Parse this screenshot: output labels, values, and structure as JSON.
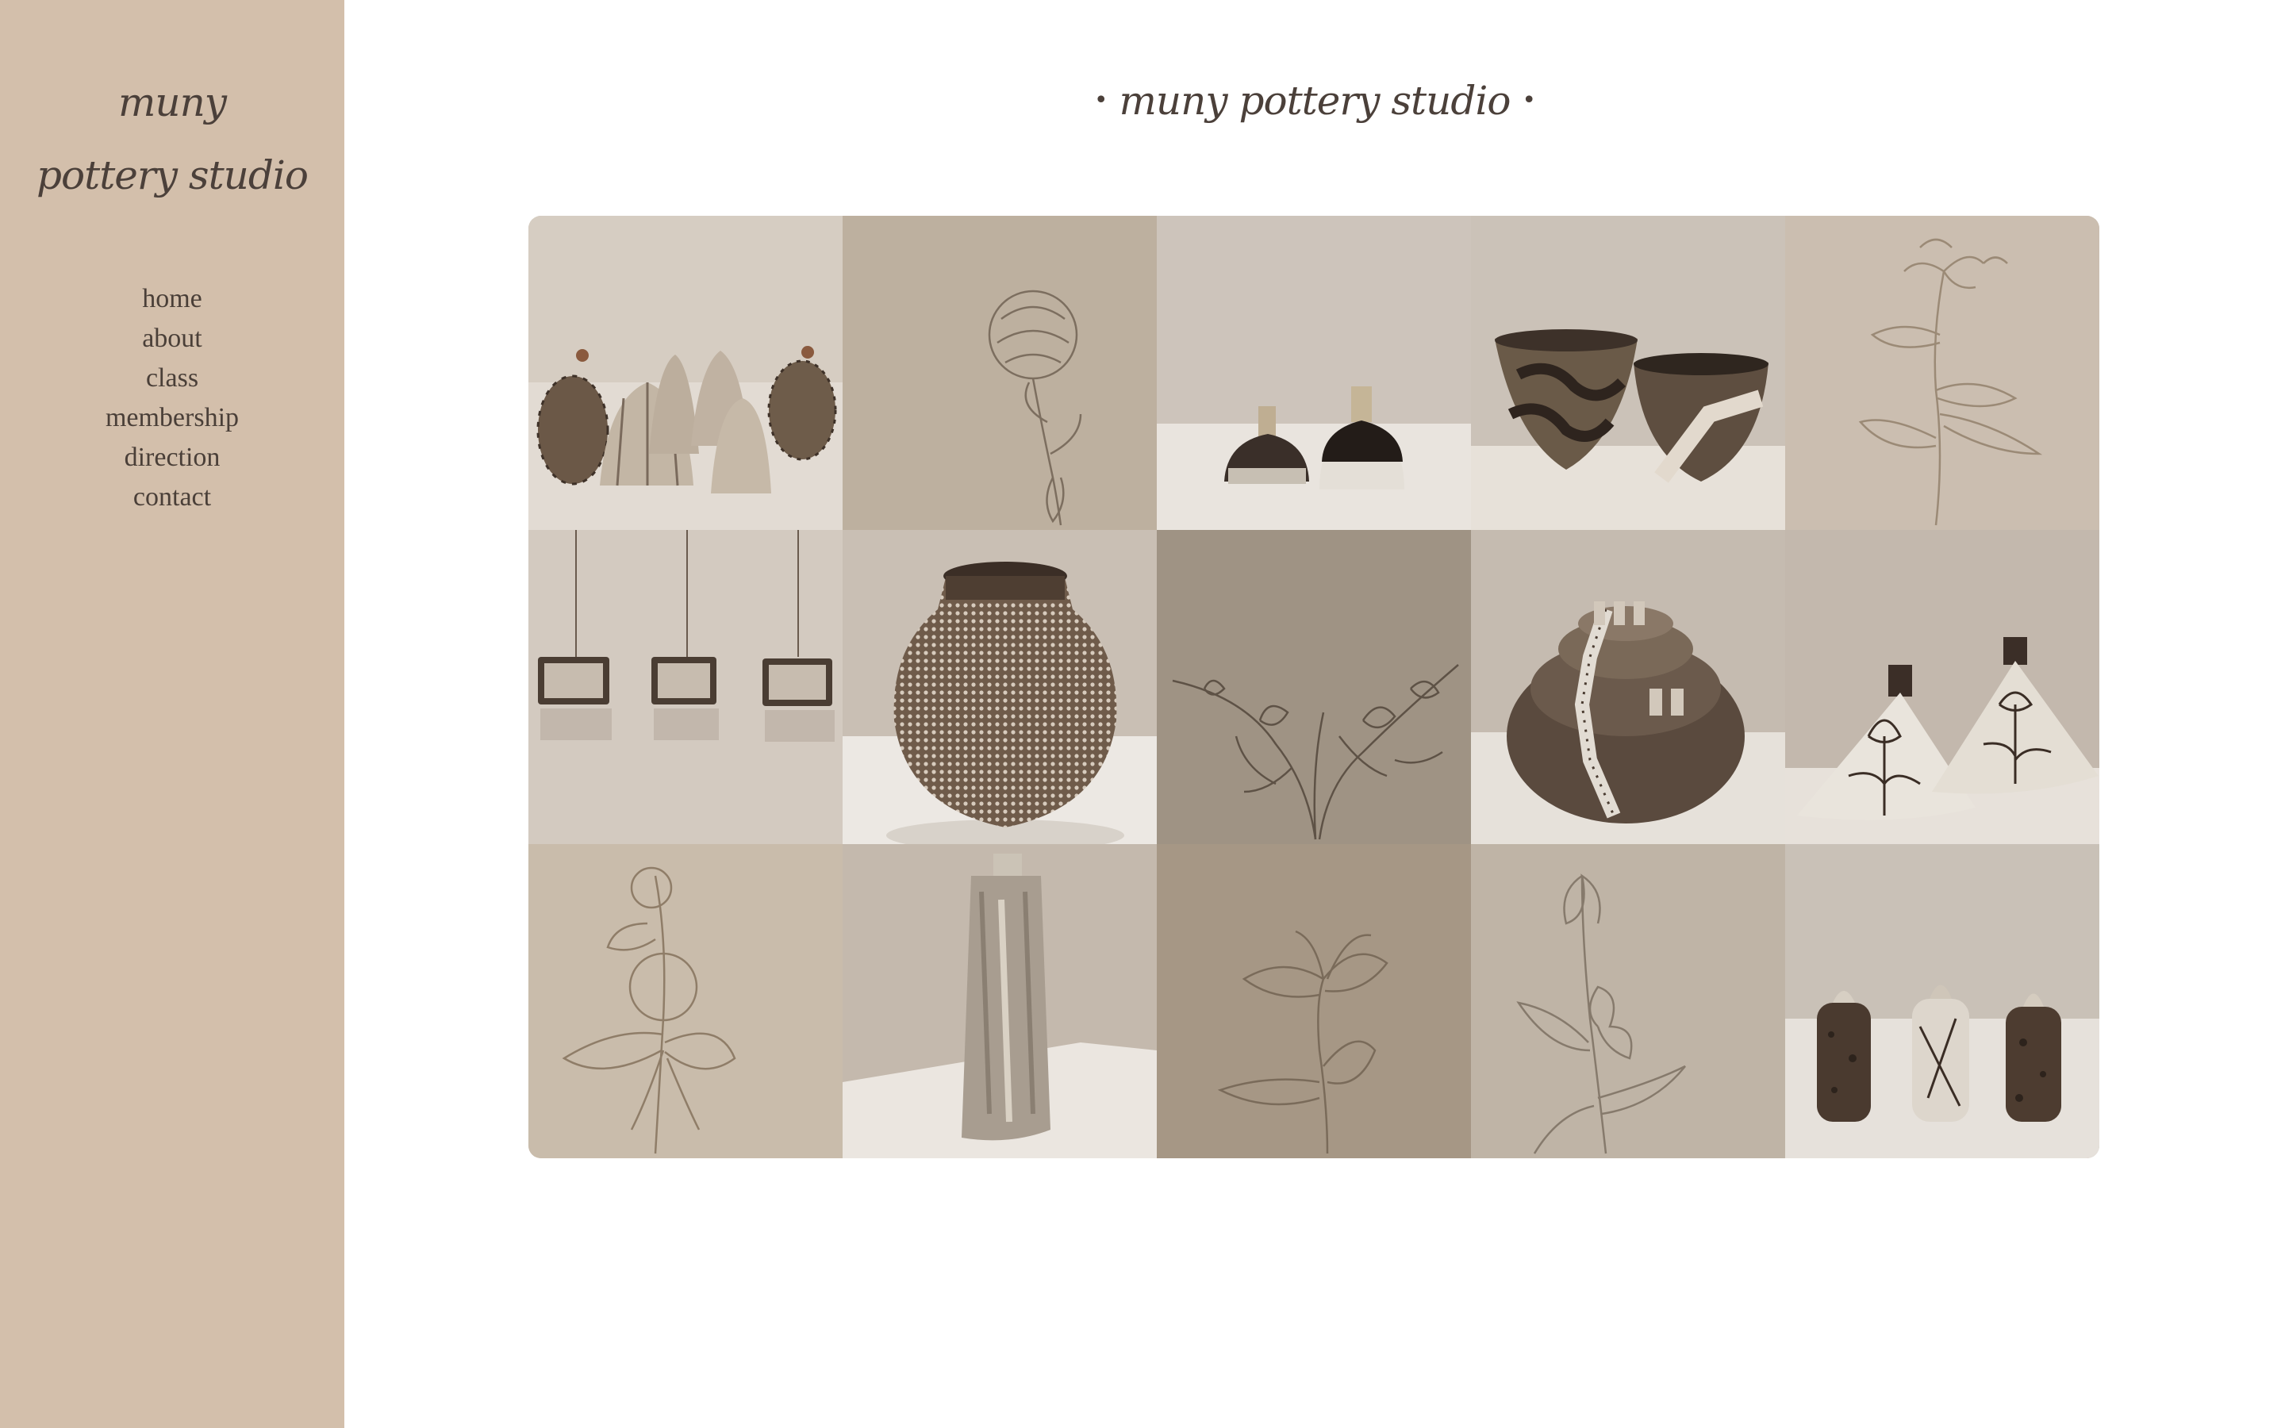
{
  "sidebar": {
    "logo_line1": "muny",
    "logo_line2": "pottery studio",
    "nav": [
      "home",
      "about",
      "class",
      "membership",
      "direction",
      "contact"
    ]
  },
  "header": {
    "title": "muny pottery studio",
    "dot": "•"
  },
  "colors": {
    "sidebar_bg": "#d3bfab",
    "text": "#4b403a",
    "page_bg": "#ffffff"
  },
  "gallery": {
    "tiles": [
      {
        "subject": "ceramic-beehive-jars-photo"
      },
      {
        "subject": "carnation-flower-drawing"
      },
      {
        "subject": "two-small-bottles-photo"
      },
      {
        "subject": "two-patterned-bowls-photo"
      },
      {
        "subject": "lily-branch-drawing"
      },
      {
        "subject": "hanging-ceramic-plaques-photo"
      },
      {
        "subject": "large-dotted-moon-jar-photo"
      },
      {
        "subject": "vine-flowers-drawing"
      },
      {
        "subject": "terraced-castle-sculpture-photo"
      },
      {
        "subject": "flower-painted-flat-bottles-photo"
      },
      {
        "subject": "clover-flower-drawing"
      },
      {
        "subject": "tall-rough-vase-photo"
      },
      {
        "subject": "tiger-lily-drawing"
      },
      {
        "subject": "iris-flower-drawing"
      },
      {
        "subject": "three-lidded-jars-photo"
      }
    ]
  }
}
